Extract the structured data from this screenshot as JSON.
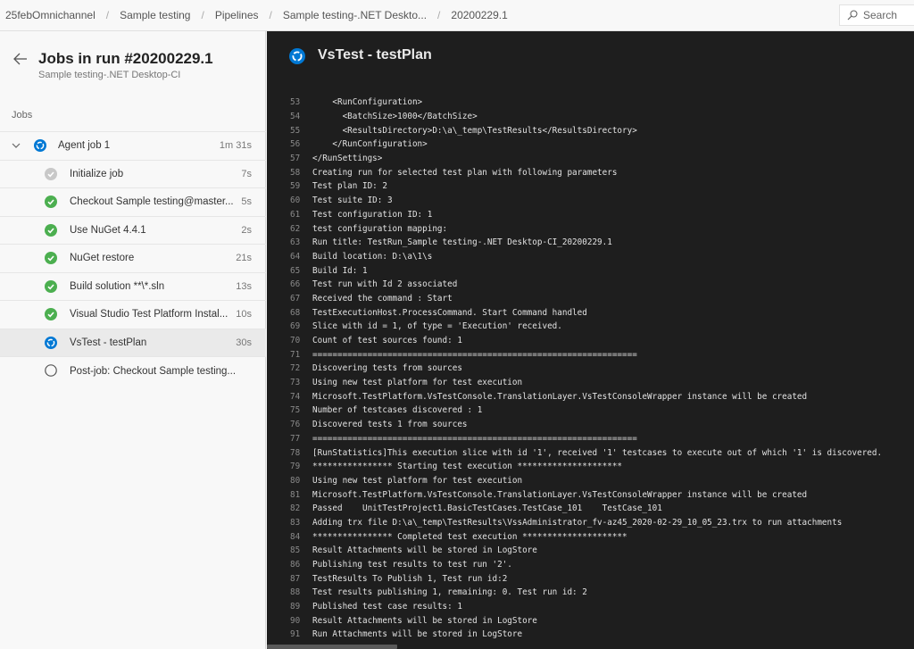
{
  "breadcrumb": [
    "25febOmnichannel",
    "Sample testing",
    "Pipelines",
    "Sample testing-.NET Deskto...",
    "20200229.1"
  ],
  "search": {
    "placeholder": "Search",
    "icon": "search-icon"
  },
  "left_panel": {
    "title": "Jobs in run #20200229.1",
    "subtitle": "Sample testing-.NET Desktop-CI",
    "section_label": "Jobs",
    "agent_job": {
      "label": "Agent job 1",
      "duration": "1m 31s",
      "status": "running",
      "expanded": true
    },
    "steps": [
      {
        "label": "Initialize job",
        "duration": "7s",
        "status": "succeeded-gray"
      },
      {
        "label": "Checkout Sample testing@master...",
        "duration": "5s",
        "status": "succeeded"
      },
      {
        "label": "Use NuGet 4.4.1",
        "duration": "2s",
        "status": "succeeded"
      },
      {
        "label": "NuGet restore",
        "duration": "21s",
        "status": "succeeded"
      },
      {
        "label": "Build solution **\\*.sln",
        "duration": "13s",
        "status": "succeeded"
      },
      {
        "label": "Visual Studio Test Platform Instal...",
        "duration": "10s",
        "status": "succeeded"
      },
      {
        "label": "VsTest - testPlan",
        "duration": "30s",
        "status": "running",
        "selected": true
      },
      {
        "label": "Post-job: Checkout Sample testing...",
        "duration": "",
        "status": "pending"
      }
    ]
  },
  "log_panel": {
    "title": "VsTest - testPlan",
    "status": "running",
    "lines": [
      {
        "n": "53",
        "t": "    <RunConfiguration>"
      },
      {
        "n": "54",
        "t": "      <BatchSize>1000</BatchSize>"
      },
      {
        "n": "55",
        "t": "      <ResultsDirectory>D:\\a\\_temp\\TestResults</ResultsDirectory>"
      },
      {
        "n": "56",
        "t": "    </RunConfiguration>"
      },
      {
        "n": "57",
        "t": "</RunSettings>"
      },
      {
        "n": "58",
        "t": "Creating run for selected test plan with following parameters"
      },
      {
        "n": "59",
        "t": "Test plan ID: 2"
      },
      {
        "n": "60",
        "t": "Test suite ID: 3"
      },
      {
        "n": "61",
        "t": "Test configuration ID: 1"
      },
      {
        "n": "62",
        "t": "test configuration mapping:"
      },
      {
        "n": "63",
        "t": "Run title: TestRun_Sample testing-.NET Desktop-CI_20200229.1"
      },
      {
        "n": "64",
        "t": "Build location: D:\\a\\1\\s"
      },
      {
        "n": "65",
        "t": "Build Id: 1"
      },
      {
        "n": "66",
        "t": "Test run with Id 2 associated"
      },
      {
        "n": "67",
        "t": "Received the command : Start"
      },
      {
        "n": "68",
        "t": "TestExecutionHost.ProcessCommand. Start Command handled"
      },
      {
        "n": "69",
        "t": "Slice with id = 1, of type = 'Execution' received."
      },
      {
        "n": "70",
        "t": "Count of test sources found: 1"
      },
      {
        "n": "71",
        "t": "================================================================="
      },
      {
        "n": "72",
        "t": "Discovering tests from sources"
      },
      {
        "n": "73",
        "t": "Using new test platform for test execution"
      },
      {
        "n": "74",
        "t": "Microsoft.TestPlatform.VsTestConsole.TranslationLayer.VsTestConsoleWrapper instance will be created"
      },
      {
        "n": "75",
        "t": "Number of testcases discovered : 1"
      },
      {
        "n": "76",
        "t": "Discovered tests 1 from sources"
      },
      {
        "n": "77",
        "t": "================================================================="
      },
      {
        "n": "78",
        "t": "[RunStatistics]This execution slice with id '1', received '1' testcases to execute out of which '1' is discovered."
      },
      {
        "n": "79",
        "t": "**************** Starting test execution *********************"
      },
      {
        "n": "80",
        "t": "Using new test platform for test execution"
      },
      {
        "n": "81",
        "t": "Microsoft.TestPlatform.VsTestConsole.TranslationLayer.VsTestConsoleWrapper instance will be created"
      },
      {
        "n": "82",
        "t": "Passed    UnitTestProject1.BasicTestCases.TestCase_101    TestCase_101"
      },
      {
        "n": "83",
        "t": "Adding trx file D:\\a\\_temp\\TestResults\\VssAdministrator_fv-az45_2020-02-29_10_05_23.trx to run attachments"
      },
      {
        "n": "84",
        "t": "**************** Completed test execution *********************"
      },
      {
        "n": "85",
        "t": "Result Attachments will be stored in LogStore"
      },
      {
        "n": "86",
        "t": "Publishing test results to test run '2'."
      },
      {
        "n": "87",
        "t": "TestResults To Publish 1, Test run id:2"
      },
      {
        "n": "88",
        "t": "Test results publishing 1, remaining: 0. Test run id: 2"
      },
      {
        "n": "89",
        "t": "Published test case results: 1"
      },
      {
        "n": "90",
        "t": "Result Attachments will be stored in LogStore"
      },
      {
        "n": "91",
        "t": "Run Attachments will be stored in LogStore"
      }
    ]
  },
  "colors": {
    "running": "#0078d4",
    "succeeded": "#4caf50",
    "succeeded_gray": "#c8c8c8",
    "log_bg": "#1e1e1e"
  }
}
